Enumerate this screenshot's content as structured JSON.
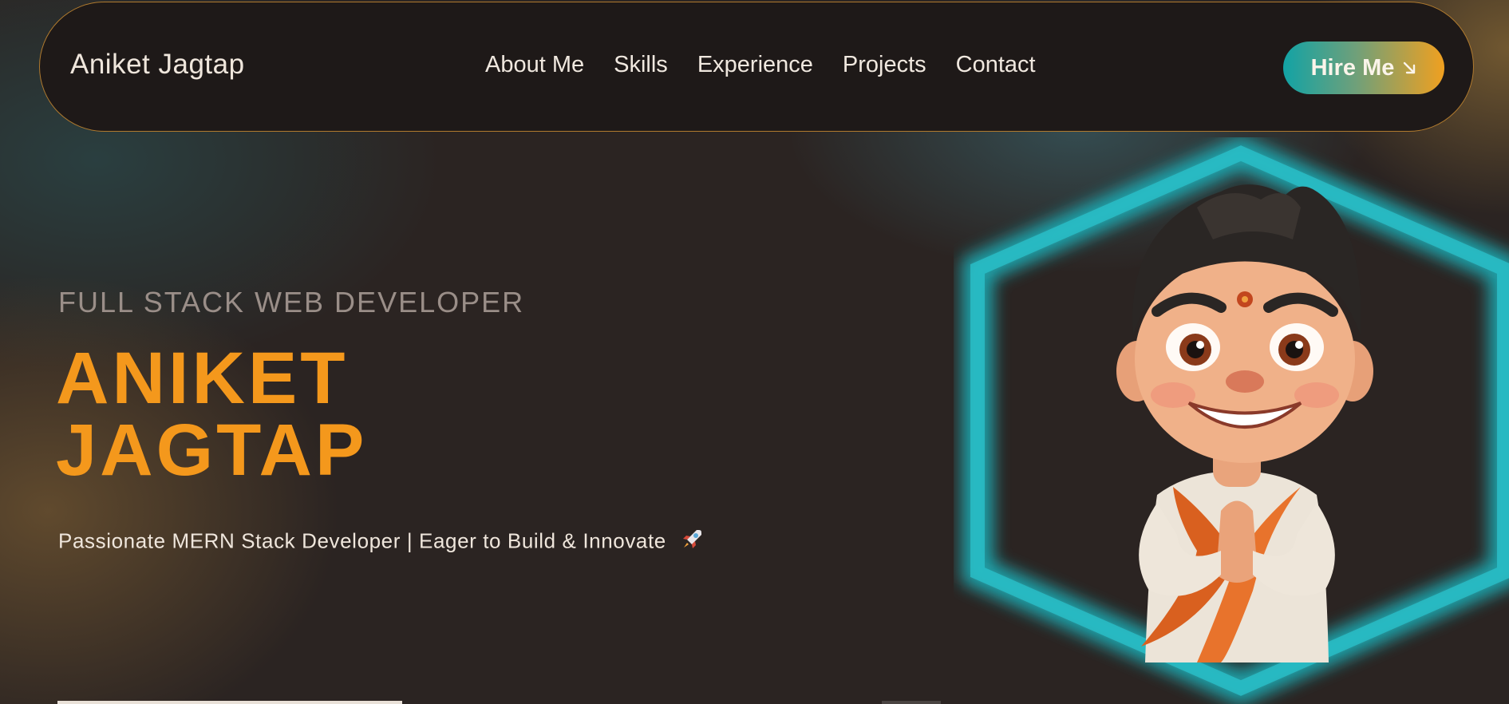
{
  "nav": {
    "brand": "Aniket Jagtap",
    "links": [
      "About Me",
      "Skills",
      "Experience",
      "Projects",
      "Contact"
    ],
    "cta_label": "Hire Me",
    "cta_icon": "arrow-down-right-icon"
  },
  "hero": {
    "subtitle": "FULL STACK WEB DEVELOPER",
    "name_line_1": "ANIKET",
    "name_line_2": "JAGTAP",
    "tagline": "Passionate MERN Stack Developer | Eager to Build & Innovate",
    "tagline_icon": "rocket-icon"
  },
  "colors": {
    "accent_orange": "#f4981c",
    "accent_teal": "#12a3a5",
    "background": "#2b2422",
    "nav_background": "#1e1918"
  }
}
